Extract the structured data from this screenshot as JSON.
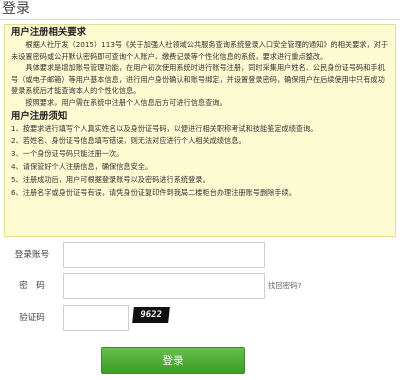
{
  "page": {
    "title": "登录"
  },
  "notice": {
    "requirements_heading": "用户注册相关要求",
    "requirements_paragraphs": [
      "根据人社厅发（2015）113号《关于加强人社领域公共服务查询系统登录入口安全管理的通知》的相关要求，对于未设置密码或公开默认密码即可查询个人账户、缴费记录等个性化信息的系统，要求进行重点整改。",
      "具体要求是增加账号管理功能，在用户初次使用系统时进行账号注册，同时采集用户姓名、公民身份证号码和手机号（或电子邮箱）等用户基本信息，进行用户身份确认和账号绑定，并设置登录密码，确保用户在后续使用中只有成功登录系统后才能查询本人的个性化信息。",
      "按照要求，用户需在系统中注册个人信息后方可进行信息查询。"
    ],
    "instructions_heading": "用户注册须知",
    "instructions": [
      "1、按要求进行填写个人真实姓名以及身份证号码，以便进行相关职称考试和技能鉴定成绩查询。",
      "2、若姓名、身份证号信息填写错误，则无法对应进行个人相关成绩信息。",
      "3、一个身份证号码只能注册一次。",
      "4、请保管好个人注册信息，确保信息安全。",
      "5、注册成功后，用户可根据登录账号以及密码进行系统登录。",
      "6、注册名字或身份证号有误，请凭身份证复印件到我局二楼柜台办理注册账号删除手续。"
    ]
  },
  "form": {
    "account_label": "登录账号",
    "account_value": "",
    "account_placeholder": "",
    "password_label": "密　码",
    "password_value": "",
    "password_placeholder": "",
    "forgot_password": "找回密码?",
    "captcha_label": "验证码",
    "captcha_value": "",
    "captcha_image_text": "9622",
    "login_button": "登录"
  }
}
